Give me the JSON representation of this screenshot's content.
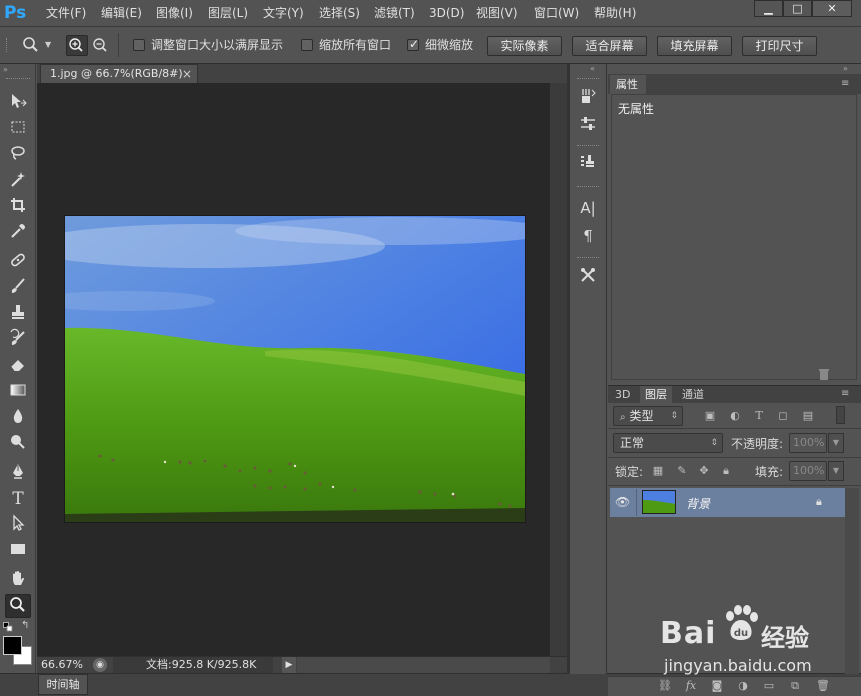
{
  "app": {
    "logo": "Ps"
  },
  "menu": [
    "文件(F)",
    "编辑(E)",
    "图像(I)",
    "图层(L)",
    "文字(Y)",
    "选择(S)",
    "滤镜(T)",
    "3D(D)",
    "视图(V)",
    "窗口(W)",
    "帮助(H)"
  ],
  "window_controls": {
    "minimize": "▁",
    "maximize": "□",
    "close": "✕"
  },
  "options": {
    "resize_windows_label": "调整窗口大小以满屏显示",
    "zoom_all_label": "缩放所有窗口",
    "scrubby_zoom_label": "细微缩放",
    "scrubby_zoom_checked": true,
    "resize_windows_checked": false,
    "zoom_all_checked": false,
    "buttons": [
      "实际像素",
      "适合屏幕",
      "填充屏幕",
      "打印尺寸"
    ]
  },
  "document": {
    "tab_title": "1.jpg @ 66.7%(RGB/8#)",
    "tab_close": "×",
    "zoom": "66.67%",
    "doc_info": "文档:925.8 K/925.8K"
  },
  "timeline": {
    "tab": "时间轴"
  },
  "properties": {
    "tab": "属性",
    "content": "无属性"
  },
  "layers": {
    "tabs": [
      "3D",
      "图层",
      "通道"
    ],
    "active_tab": "图层",
    "filter_kind": "类型",
    "blend_mode": "正常",
    "opacity_label": "不透明度:",
    "opacity_value": "100%",
    "lock_label": "锁定:",
    "fill_label": "填充:",
    "fill_value": "100%",
    "layer_name": "背景"
  },
  "watermark": {
    "brand": "Bai",
    "brand2": "经验",
    "url": "jingyan.baidu.com"
  },
  "colors": {
    "ui_bg": "#535353",
    "canvas_bg": "#282828",
    "accent_logo": "#31a8ff",
    "selected_layer": "#6b7f9e"
  }
}
